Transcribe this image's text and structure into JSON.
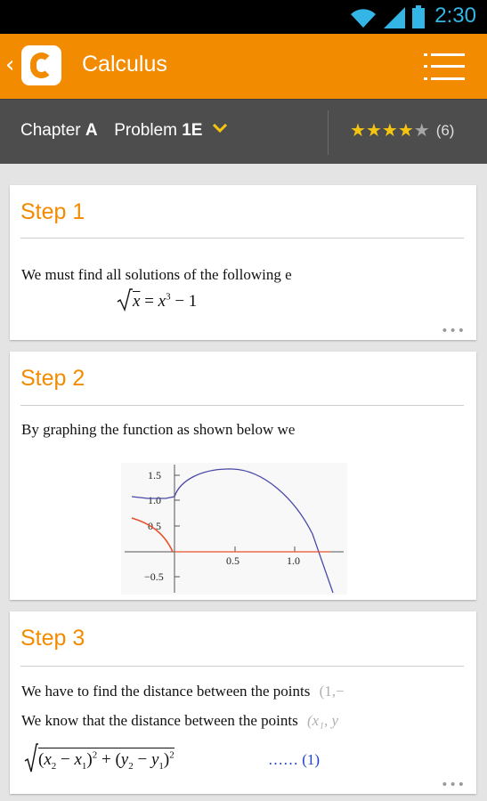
{
  "status_bar": {
    "time": "2:30"
  },
  "app_bar": {
    "back_glyph": "‹",
    "title": "Calculus",
    "menu_icon": "list-menu-icon"
  },
  "chapter_bar": {
    "chapter_prefix": "Chapter",
    "chapter": "A",
    "problem_prefix": "Problem",
    "problem": "1E",
    "rating_stars": 4,
    "rating_max": 5,
    "rating_count": "(6)"
  },
  "steps": [
    {
      "title": "Step 1",
      "lines": [
        "We must find all solutions of the following e"
      ],
      "equation": {
        "lhs_radicand": "x",
        "rhs": "x",
        "rhs_exp": "3",
        "rhs_tail": "− 1"
      }
    },
    {
      "title": "Step 2",
      "lines": [
        "By graphing the function as shown below we"
      ],
      "graph": {
        "y_ticks": [
          "1.5",
          "1.0",
          "0.5",
          "−0.5"
        ],
        "x_ticks": [
          "0.5",
          "1.0"
        ]
      }
    },
    {
      "title": "Step 3",
      "lines": [
        "We have to find the distance between the points",
        "We know that the distance between the points"
      ],
      "point_1": "(1,−",
      "point_2": "(x₁, y",
      "formula_label": "…… (1)"
    }
  ],
  "more_glyph": "•••",
  "colors": {
    "accent": "#f28b00",
    "status_blue": "#33b5e5",
    "star_on": "#f6c510",
    "chapter_bar": "#4d4d4d",
    "curve_blue": "#4a4aa8",
    "curve_red": "#e8502a"
  }
}
